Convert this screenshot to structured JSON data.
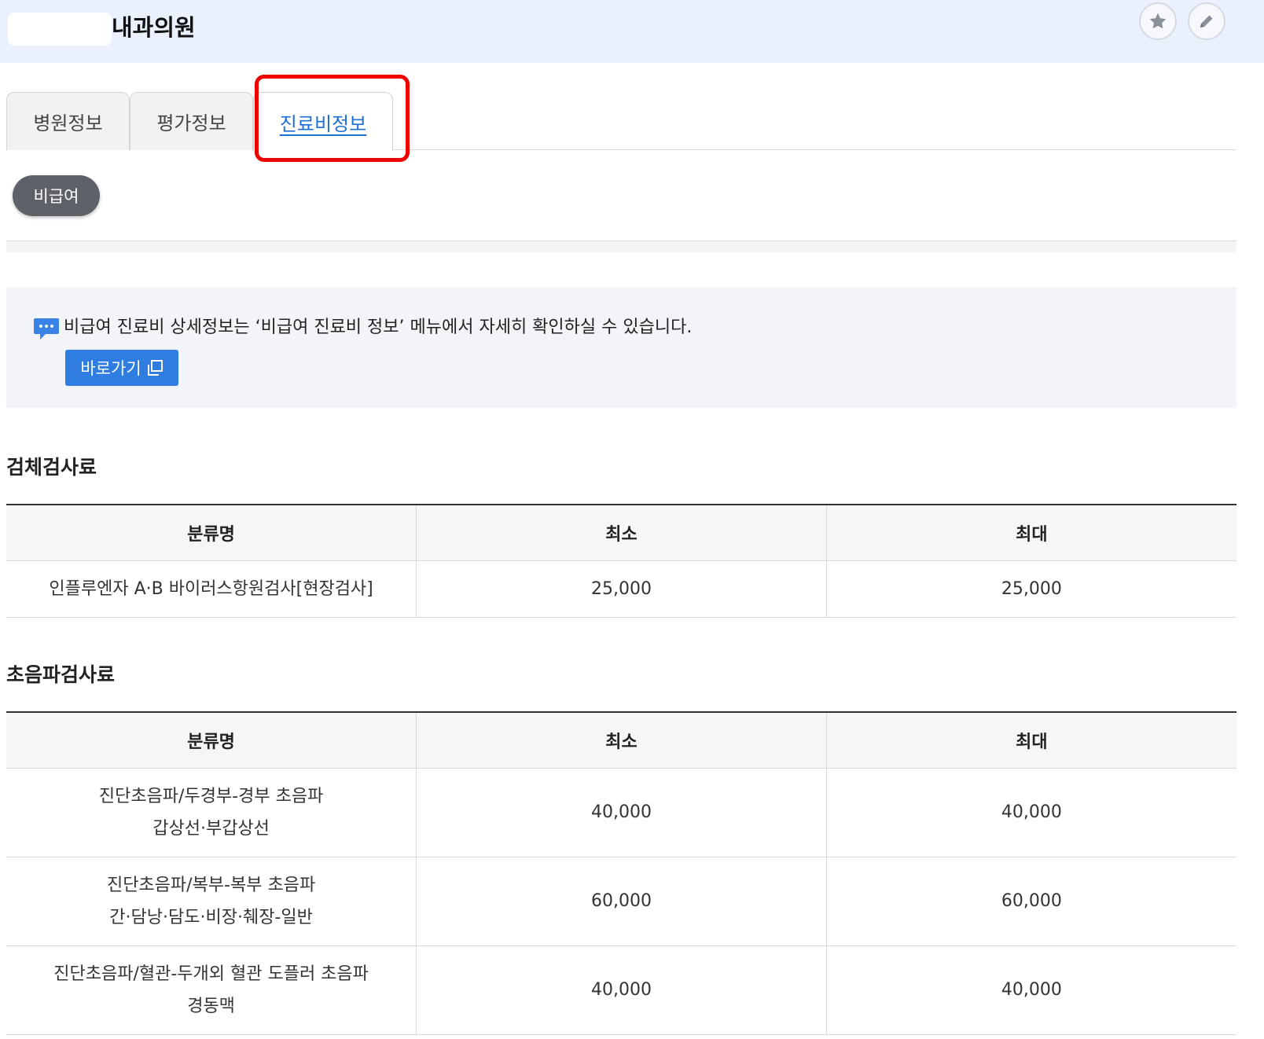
{
  "header": {
    "hospital_name": "내과의원",
    "favorite_icon": "star-icon",
    "edit_icon": "pencil-icon"
  },
  "tabs": [
    {
      "label": "병원정보",
      "active": false
    },
    {
      "label": "평가정보",
      "active": false
    },
    {
      "label": "진료비정보",
      "active": true
    }
  ],
  "chip": {
    "label": "비급여"
  },
  "notice": {
    "text": "비급여 진료비 상세정보는 ‘비급여 진료비 정보’ 메뉴에서 자세히 확인하실 수 있습니다.",
    "button_label": "바로가기",
    "icon": "chat-bubble-icon",
    "button_icon": "new-window-icon"
  },
  "sections": [
    {
      "title": "검체검사료",
      "columns": [
        "분류명",
        "최소",
        "최대"
      ],
      "rows": [
        {
          "name_line1": "인플루엔자 A·B 바이러스항원검사[현장검사]",
          "name_line2": "",
          "min": "25,000",
          "max": "25,000"
        }
      ]
    },
    {
      "title": "초음파검사료",
      "columns": [
        "분류명",
        "최소",
        "최대"
      ],
      "rows": [
        {
          "name_line1": "진단초음파/두경부-경부 초음파",
          "name_line2": "갑상선·부갑상선",
          "min": "40,000",
          "max": "40,000"
        },
        {
          "name_line1": "진단초음파/복부-복부 초음파",
          "name_line2": "간·담낭·담도·비장·췌장-일반",
          "min": "60,000",
          "max": "60,000"
        },
        {
          "name_line1": "진단초음파/혈관-두개외 혈관 도플러 초음파",
          "name_line2": "경동맥",
          "min": "40,000",
          "max": "40,000"
        }
      ]
    }
  ],
  "colors": {
    "header_bg": "#eaf1fc",
    "active_tab_text": "#1c6fd6",
    "highlight": "#ee0000",
    "chip_bg": "#5e6167",
    "button_bg": "#2f7de1"
  }
}
